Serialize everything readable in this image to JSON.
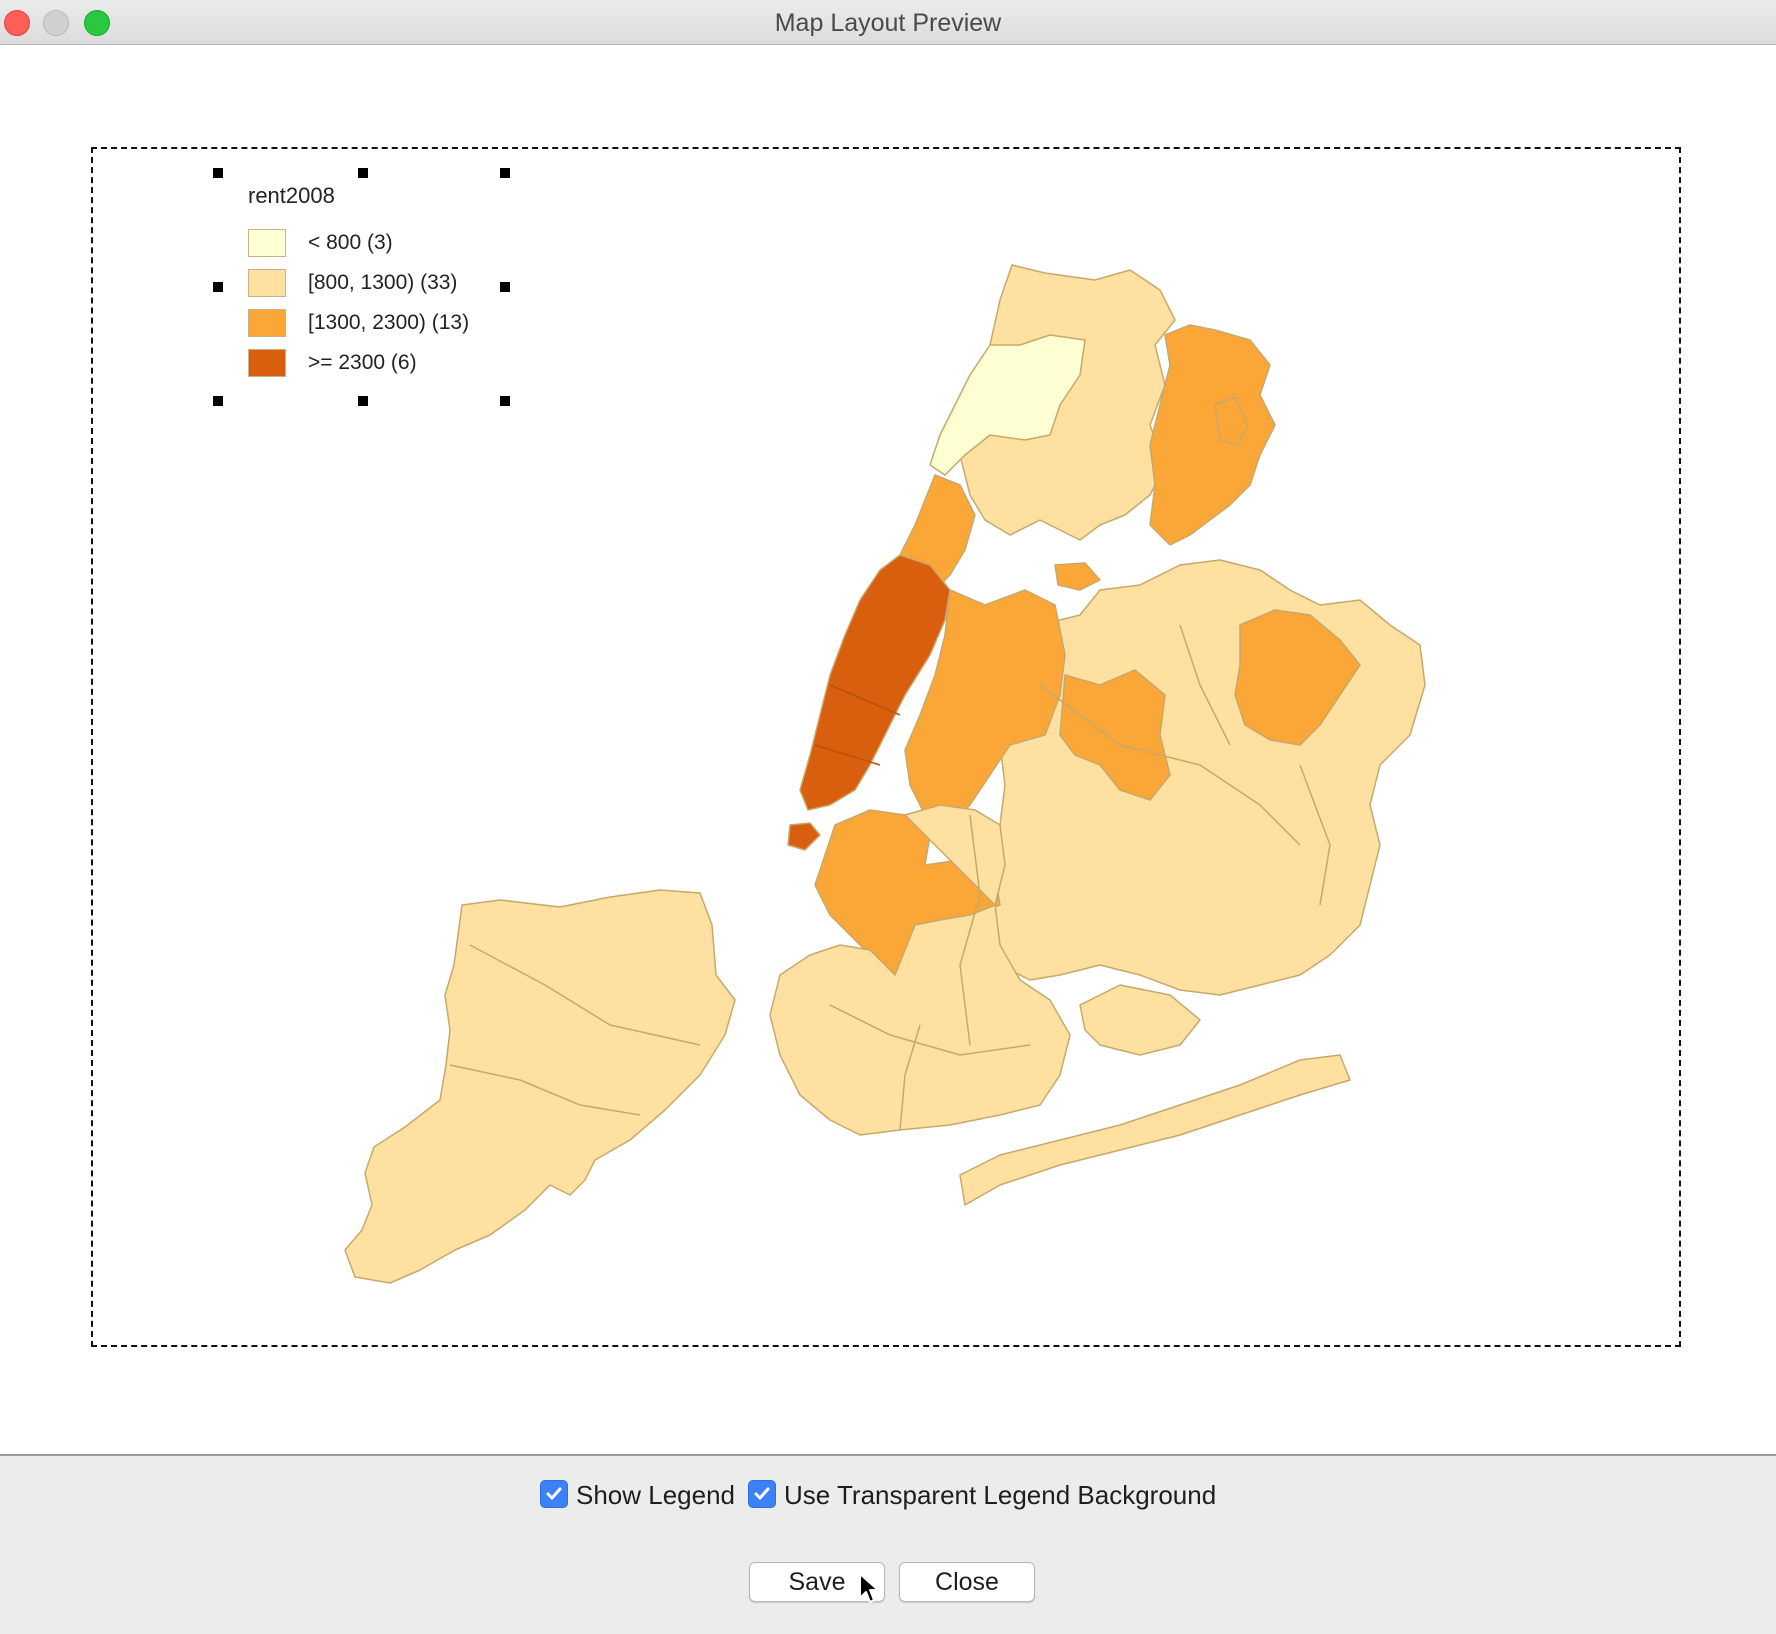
{
  "window": {
    "title": "Map Layout Preview"
  },
  "legend": {
    "title": "rent2008",
    "items": [
      {
        "label": "< 800 (3)",
        "color": "#ffffd4"
      },
      {
        "label": "[800, 1300) (33)",
        "color": "#fee0a1"
      },
      {
        "label": "[1300, 2300) (13)",
        "color": "#fba738"
      },
      {
        "label": ">= 2300 (6)",
        "color": "#d95f0e"
      }
    ]
  },
  "options": {
    "show_legend": {
      "label": "Show Legend",
      "checked": true
    },
    "transparent_legend": {
      "label": "Use Transparent Legend Background",
      "checked": true
    }
  },
  "buttons": {
    "save": "Save",
    "close": "Close"
  },
  "colors": {
    "class1": "#ffffd4",
    "class2": "#fee0a1",
    "class3": "#fba738",
    "class4": "#d95f0e",
    "boundary": "#c8a86a",
    "checkbox": "#3b82f6"
  }
}
